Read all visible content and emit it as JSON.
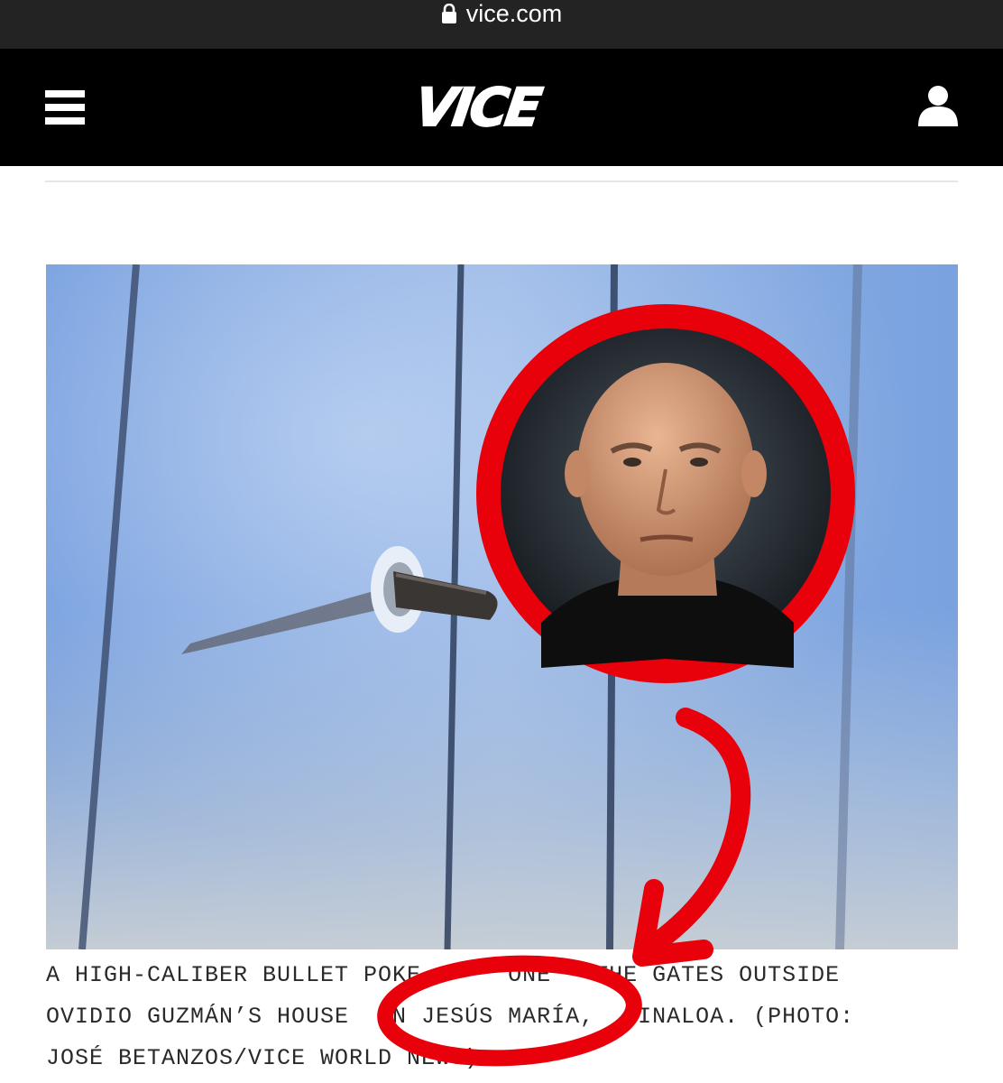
{
  "browser": {
    "url": "vice.com",
    "lock_icon": "lock-icon"
  },
  "header": {
    "logo_text": "VICE",
    "menu_icon": "hamburger-menu-icon",
    "user_icon": "user-account-icon",
    "background": "#000000"
  },
  "article": {
    "caption_lines": [
      "A HIGH-CALIBER BULLET POKE      ONE   THE GATES OUTSIDE",
      "OVIDIO GUZMÁN’S HOUSE   N JESÚS MARÍA,   INALOA. (PHOTO:",
      "JOSÉ BETANZOS/VICE WORLD NEWS)"
    ]
  },
  "annotation": {
    "color": "#e8000b",
    "inset_portrait": "bald-man-portrait-photo"
  }
}
